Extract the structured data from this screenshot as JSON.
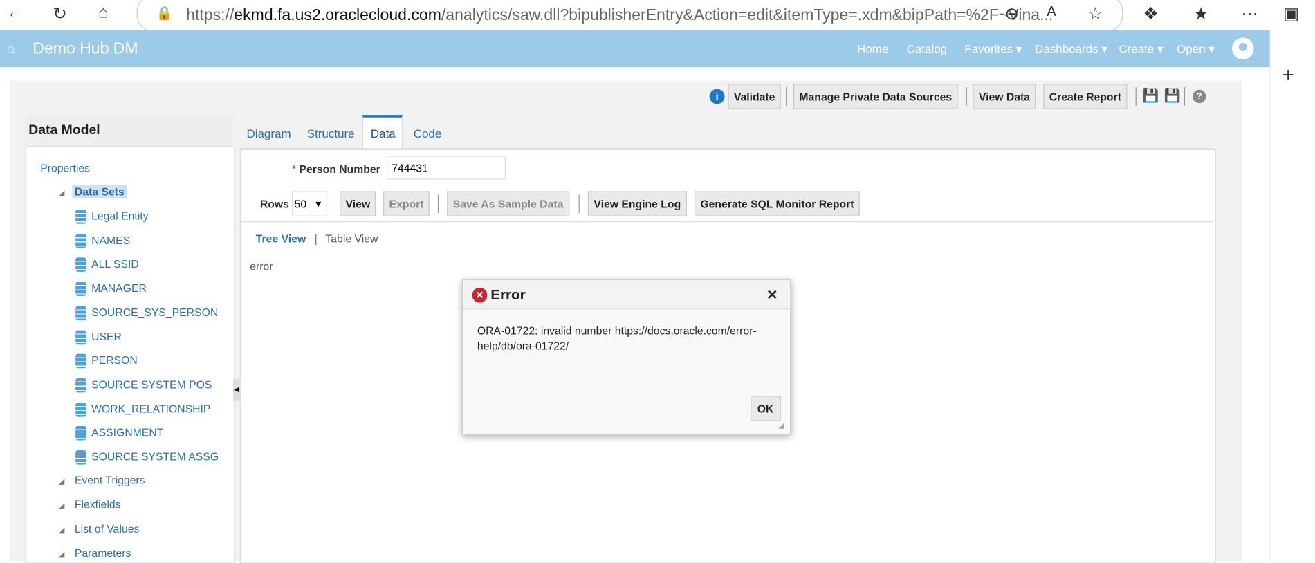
{
  "browser": {
    "url_prefix": "https://",
    "url_host": "ekmd.fa.us2.oraclecloud.com",
    "url_path": "/analytics/saw.dll?bipublisherEntry&Action=edit&itemType=.xdm&bipPath=%2F~Vina..."
  },
  "app": {
    "title": "Demo Hub DM",
    "nav": [
      "Home",
      "Catalog",
      "Favorites ▾",
      "Dashboards ▾",
      "Create ▾",
      "Open ▾"
    ]
  },
  "toolbar": {
    "validate": "Validate",
    "manage": "Manage Private Data Sources",
    "view_data": "View Data",
    "create_report": "Create Report"
  },
  "left": {
    "title": "Data Model",
    "properties": "Properties",
    "data_sets": "Data Sets",
    "datasets": [
      "Legal Entity",
      "NAMES",
      "ALL SSID",
      "MANAGER",
      "SOURCE_SYS_PERSON",
      "USER",
      "PERSON",
      "SOURCE SYSTEM POS",
      "WORK_RELATIONSHIP",
      "ASSIGNMENT",
      "SOURCE SYSTEM ASSG"
    ],
    "sections": [
      "Event Triggers",
      "Flexfields",
      "List of Values",
      "Parameters"
    ]
  },
  "tabs": [
    "Diagram",
    "Structure",
    "Data",
    "Code"
  ],
  "main": {
    "required": "*",
    "param_label": "Person Number",
    "param_value": "744431",
    "rows_label": "Rows",
    "rows_value": "50",
    "view": "View",
    "export": "Export",
    "save_sample": "Save As Sample Data",
    "engine_log": "View Engine Log",
    "sql_monitor": "Generate SQL Monitor Report",
    "tree_view": "Tree View",
    "divider": "|",
    "table_view": "Table View",
    "output": "error"
  },
  "dialog": {
    "title": "Error",
    "message": "ORA-01722: invalid number https://docs.oracle.com/error-help/db/ora-01722/",
    "ok": "OK"
  }
}
